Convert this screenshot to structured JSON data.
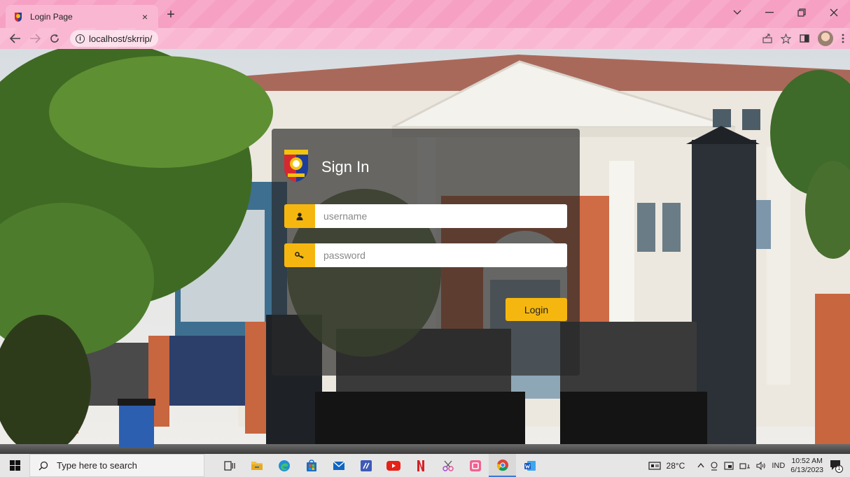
{
  "browser": {
    "tab_title": "Login Page",
    "tab_close": "×",
    "new_tab": "+",
    "url": "localhost/skrrip/",
    "url_info": "i"
  },
  "login": {
    "title": "Sign In",
    "username_placeholder": "username",
    "password_placeholder": "password",
    "login_label": "Login",
    "accent_color": "#f5b70f"
  },
  "taskbar": {
    "search_placeholder": "Type here to search",
    "weather": "28°C",
    "language": "IND",
    "time": "10:52 AM",
    "date": "6/13/2023",
    "notification_count": "1",
    "apps": [
      "task-view",
      "file-explorer",
      "edge",
      "store",
      "mail",
      "visual-studio",
      "youtube",
      "netflix",
      "snipping-tool",
      "app-puzzle",
      "chrome",
      "word"
    ]
  }
}
